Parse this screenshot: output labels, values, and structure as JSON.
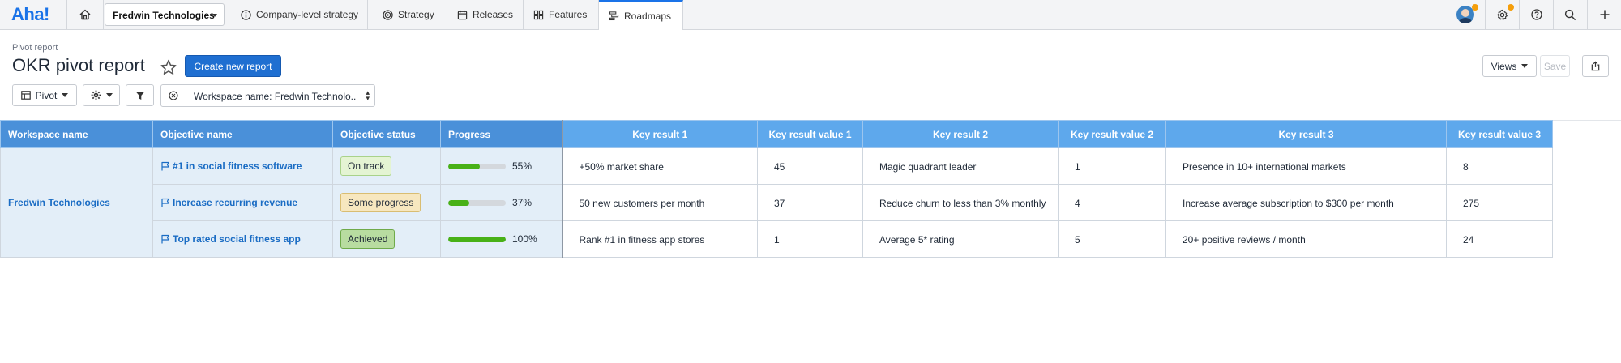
{
  "nav": {
    "brand": "Aha!",
    "workspace_select": "Fredwin Technologies",
    "tabs": [
      {
        "label": "Company-level strategy",
        "icon": "info-circle-icon"
      },
      {
        "label": "Strategy",
        "icon": "target-icon"
      },
      {
        "label": "Releases",
        "icon": "calendar-icon"
      },
      {
        "label": "Features",
        "icon": "grid-icon"
      },
      {
        "label": "Roadmaps",
        "icon": "roadmap-icon",
        "active": true
      }
    ],
    "accent": "#1a73e8",
    "notification_color": "#f59e0b"
  },
  "header": {
    "breadcrumb": "Pivot report",
    "title": "OKR pivot report",
    "create_button": "Create new report",
    "views_button": "Views",
    "save_button": "Save"
  },
  "toolbar": {
    "pivot_button": "Pivot",
    "filter_text": "Workspace name: Fredwin Technolo..."
  },
  "table": {
    "columns": [
      "Workspace name",
      "Objective name",
      "Objective status",
      "Progress",
      "Key result 1",
      "Key result value 1",
      "Key result 2",
      "Key result value 2",
      "Key result 3",
      "Key result value 3"
    ],
    "workspace": "Fredwin Technologies",
    "rows": [
      {
        "objective": "#1 in social fitness software",
        "status": "On track",
        "status_bg": "#e4f4d3",
        "status_border": "#a9d28a",
        "progress": 0.55,
        "progress_label": "55%",
        "kr1": "+50% market share",
        "kv1": "45",
        "kr2": "Magic quadrant leader",
        "kv2": "1",
        "kr3": "Presence in 10+ international markets",
        "kv3": "8"
      },
      {
        "objective": "Increase recurring revenue",
        "status": "Some progress",
        "status_bg": "#f7e7bf",
        "status_border": "#d9bd72",
        "progress": 0.37,
        "progress_label": "37%",
        "kr1": "50 new customers per month",
        "kv1": "37",
        "kr2": "Reduce churn to less than 3% monthly",
        "kv2": "4",
        "kr3": "Increase average subscription to $300 per month",
        "kv3": "275"
      },
      {
        "objective": "Top rated social fitness app",
        "status": "Achieved",
        "status_bg": "#b8dca0",
        "status_border": "#6faa4a",
        "progress": 1.0,
        "progress_label": "100%",
        "kr1": "Rank #1 in fitness app stores",
        "kv1": "1",
        "kr2": "Average 5* rating",
        "kv2": "5",
        "kr3": "20+ positive reviews / month",
        "kv3": "24"
      }
    ]
  }
}
